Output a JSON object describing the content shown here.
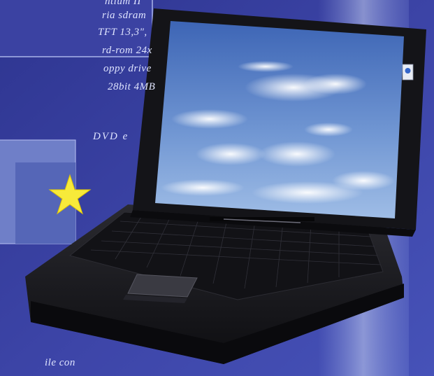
{
  "ad_text": {
    "lines": [
      "ntium II",
      "ria sdram",
      "TFT 13,3\",",
      "rd-rom 24x",
      "oppy drive",
      "28bit 4MB",
      "DVD e"
    ],
    "footer": "ile con"
  },
  "colors": {
    "background": "#3a3fa0",
    "star": "#f7ea3a",
    "laptop": "#15151a",
    "sky": "#5c86c8"
  },
  "icons": [
    "star-icon",
    "screen-sticker-icon"
  ]
}
